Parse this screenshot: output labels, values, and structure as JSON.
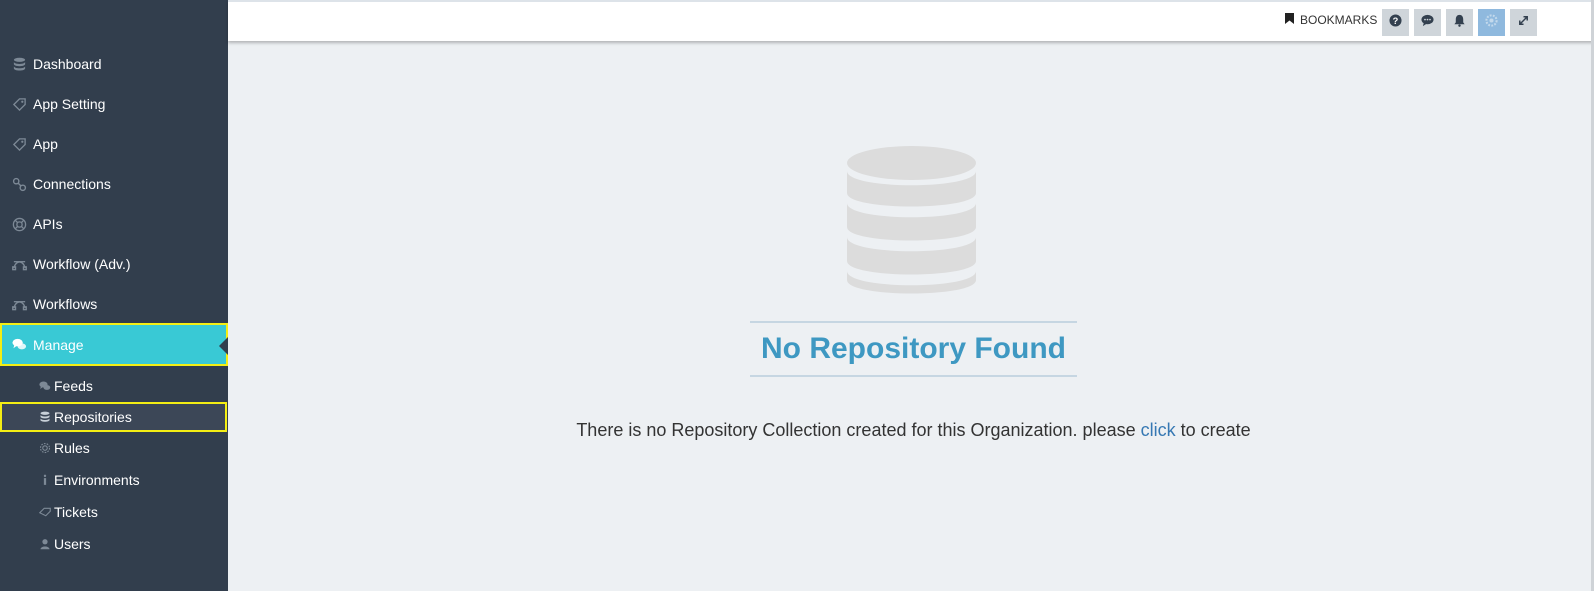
{
  "sidebar": {
    "items": [
      {
        "label": "Dashboard",
        "icon": "database-icon"
      },
      {
        "label": "App Setting",
        "icon": "tag-icon"
      },
      {
        "label": "App",
        "icon": "tag-icon"
      },
      {
        "label": "Connections",
        "icon": "link-icon"
      },
      {
        "label": "APIs",
        "icon": "lifebuoy-icon"
      },
      {
        "label": "Workflow (Adv.)",
        "icon": "bezier-icon"
      },
      {
        "label": "Workflows",
        "icon": "bezier-icon"
      },
      {
        "label": "Manage",
        "icon": "comments-icon"
      }
    ],
    "subitems": [
      {
        "label": "Feeds",
        "icon": "comments-icon"
      },
      {
        "label": "Repositories",
        "icon": "database-icon"
      },
      {
        "label": "Rules",
        "icon": "gear-icon"
      },
      {
        "label": "Environments",
        "icon": "info-icon"
      },
      {
        "label": "Tickets",
        "icon": "ticket-icon"
      },
      {
        "label": "Users",
        "icon": "user-icon"
      }
    ]
  },
  "topbar": {
    "bookmarks_label": "BOOKMARKS",
    "buttons": [
      "help-icon",
      "chat-icon",
      "bell-icon",
      "settings-icon",
      "expand-icon"
    ]
  },
  "main": {
    "empty_title": "No Repository Found",
    "message_before": "There is no Repository Collection created for this Organization. please",
    "link_text": "click",
    "message_after": "to create"
  },
  "colors": {
    "sidebar_bg": "#323e4d",
    "active_bg": "#39c9d5",
    "highlight": "#f4ee14",
    "title": "#3e98c2",
    "link": "#3678b3"
  }
}
